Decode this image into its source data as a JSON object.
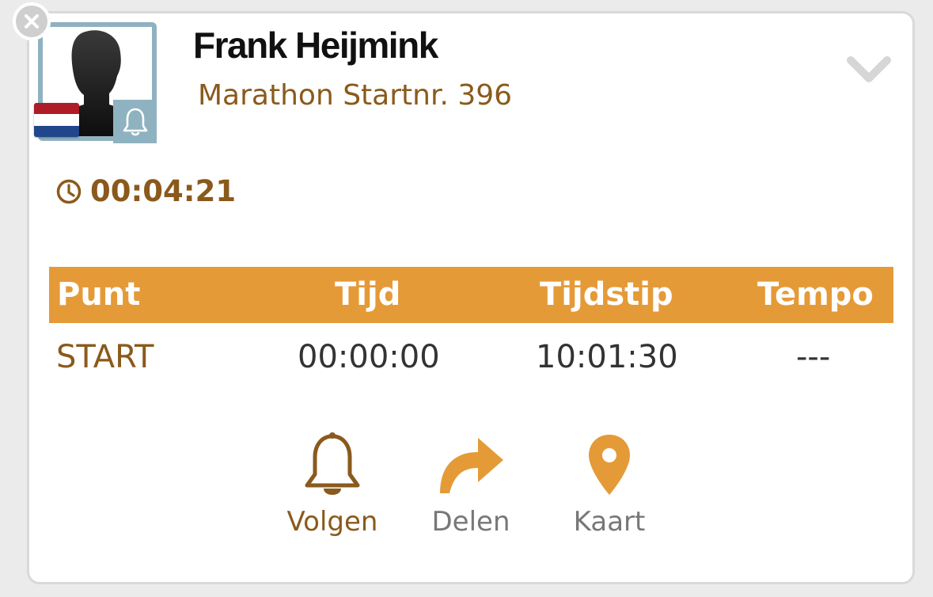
{
  "runner": {
    "name": "Frank Heijmink",
    "subtitle": "Marathon Startnr. 396",
    "flag": [
      "#ae1c28",
      "#ffffff",
      "#21468b"
    ]
  },
  "timer": {
    "elapsed": "00:04:21"
  },
  "table": {
    "headers": [
      "Punt",
      "Tijd",
      "Tijdstip",
      "Tempo"
    ],
    "rows": [
      [
        "START",
        "00:00:00",
        "10:01:30",
        "---"
      ]
    ]
  },
  "actions": {
    "follow": "Volgen",
    "share": "Delen",
    "map": "Kaart"
  },
  "colors": {
    "accent": "#e59a38",
    "brown": "#8a5a1c",
    "avatar_frame": "#8fb2c0"
  },
  "icons": [
    "close-icon",
    "bell-icon",
    "chevron-down-icon",
    "clock-icon",
    "share-arrow-icon",
    "map-pin-icon"
  ]
}
